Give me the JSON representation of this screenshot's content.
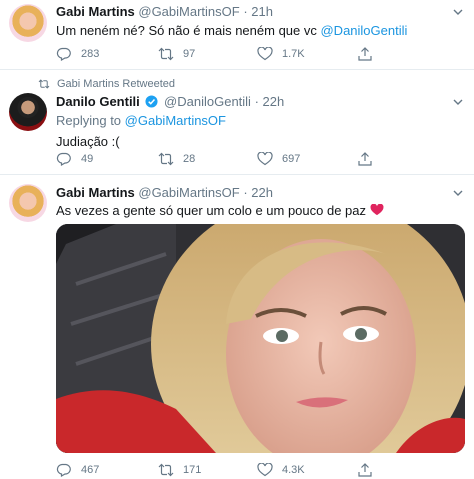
{
  "tweets": [
    {
      "name": "Gabi Martins",
      "handle": "@GabiMartinsOF",
      "time": "21h",
      "text_prefix": "Um neném né? Só não é mais neném que vc ",
      "mention": "@DaniloGentili",
      "replies": "283",
      "retweets": "97",
      "likes": "1.7K"
    },
    {
      "retweeted_by": "Gabi Martins Retweeted",
      "name": "Danilo Gentili",
      "handle": "@DaniloGentili",
      "time": "22h",
      "verified": true,
      "replying_label": "Replying to ",
      "replying_to": "@GabiMartinsOF",
      "text": "Judiação :(",
      "replies": "49",
      "retweets": "28",
      "likes": "697"
    },
    {
      "name": "Gabi Martins",
      "handle": "@GabiMartinsOF",
      "time": "22h",
      "text": "As vezes a gente só quer um colo e um pouco de paz",
      "emoji": "❤️",
      "replies": "467",
      "retweets": "171",
      "likes": "4.3K"
    }
  ],
  "colors": {
    "link": "#1b95e0",
    "muted": "#657786",
    "verified": "#1da1f2",
    "heart": "#e0245e"
  },
  "icons": [
    "reply-icon",
    "retweet-icon",
    "like-icon",
    "share-icon",
    "caret-down-icon",
    "verified-badge-icon",
    "heart-emoji"
  ]
}
